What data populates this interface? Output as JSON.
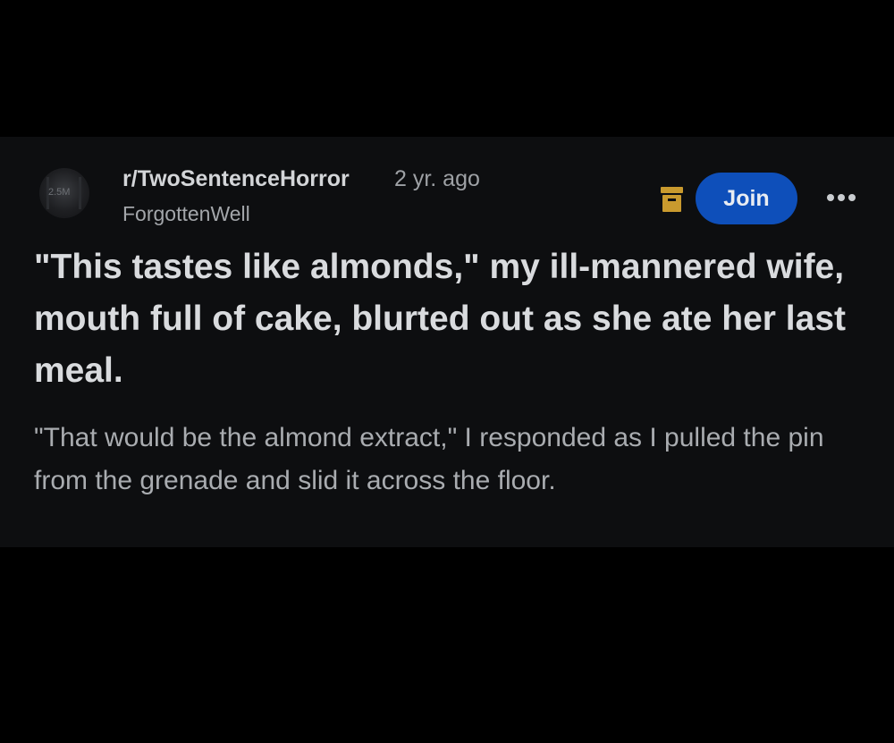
{
  "post": {
    "subreddit": "r/TwoSentenceHorror",
    "age": "2 yr. ago",
    "author": "ForgottenWell",
    "avatar_text": "2.5M",
    "join_label": "Join",
    "title": "\"This tastes like almonds,\" my ill-mannered wife, mouth full of cake, blurted out as she ate her last meal.",
    "body": "\"That would be the almond extract,\" I responded as I pulled the pin from the grenade and slid it across the floor."
  },
  "icons": {
    "save": "save-bookmark-icon",
    "more": "more-options-icon"
  },
  "colors": {
    "background": "#000000",
    "card": "#0d0e10",
    "join_button": "#0e4fba",
    "save_icon": "#c99a2e",
    "title_text": "#d9dbde",
    "body_text": "#a9acb0"
  }
}
